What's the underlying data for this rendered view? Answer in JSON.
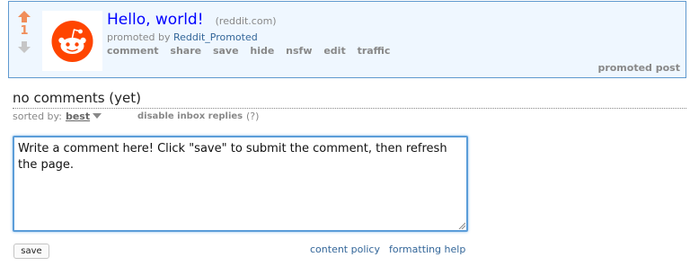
{
  "post": {
    "score": "1",
    "title": "Hello, world!",
    "domain": "(reddit.com)",
    "promoted_by_prefix": "promoted by",
    "author": "Reddit_Promoted",
    "buttons": [
      "comment",
      "share",
      "save",
      "hide",
      "nsfw",
      "edit",
      "traffic"
    ],
    "promoted_label": "promoted post",
    "thumbnail_icon": "reddit-alien-icon"
  },
  "comments": {
    "heading": "no comments (yet)",
    "sort_label": "sorted by:",
    "sort_value": "best",
    "inbox_toggle": "disable inbox replies",
    "help": "(?)"
  },
  "editor": {
    "text": "Write a comment here! Click \"save\" to submit the comment, then refresh the page.",
    "save_label": "save",
    "links": [
      "content policy",
      "formatting help"
    ]
  },
  "colors": {
    "upvote": "#f08e5a",
    "downvote": "#c6c6c6",
    "title_link": "#0000ff",
    "promo_background": "#eff7ff",
    "promo_border": "#5f99cf",
    "reddit_orange": "#ff4500",
    "focus_border": "#5b9dd9"
  }
}
